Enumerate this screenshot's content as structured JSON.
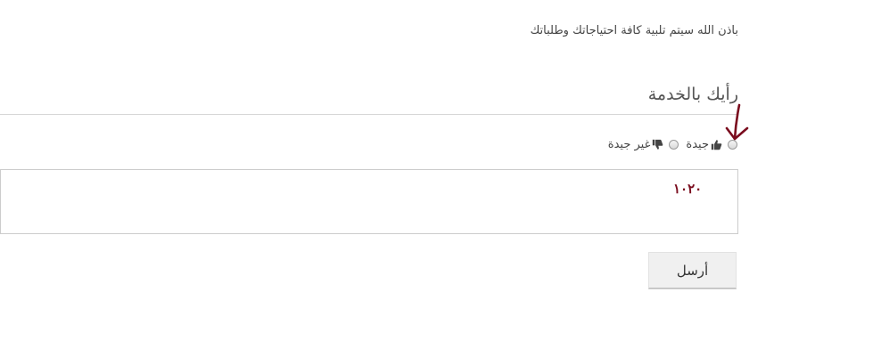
{
  "intro": {
    "text": "باذن الله سيتم تلبية كافة احتياجاتك وطلباتك"
  },
  "feedback": {
    "title": "رأيك بالخدمة",
    "options": [
      {
        "label": "جيدة",
        "icon": "thumbs-up-icon",
        "selected": false
      },
      {
        "label": "غير جيدة",
        "icon": "thumbs-down-icon",
        "selected": false
      }
    ],
    "comment_value": "",
    "submit_label": "أرسل"
  },
  "annotations": {
    "color": "#7a0c1e",
    "handwritten_text": "١٠٢٠"
  }
}
